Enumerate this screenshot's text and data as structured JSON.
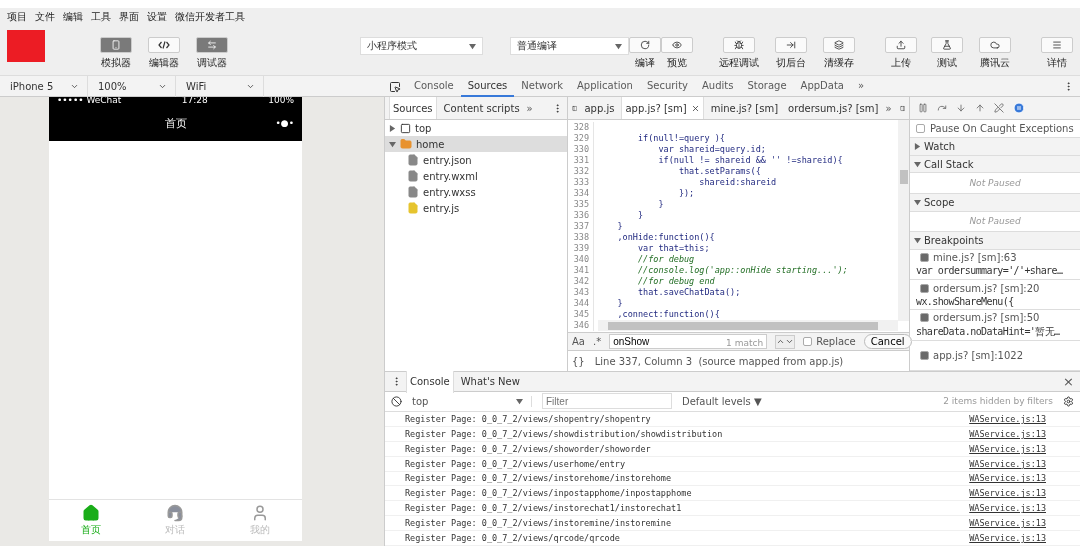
{
  "menu": [
    "项目",
    "文件",
    "编辑",
    "工具",
    "界面",
    "设置",
    "微信开发者工具"
  ],
  "view_buttons": [
    {
      "label": "模拟器",
      "selected": true
    },
    {
      "label": "编辑器",
      "selected": false
    },
    {
      "label": "调试器",
      "selected": true
    }
  ],
  "mode_select": {
    "value": "小程序模式"
  },
  "compile_select": {
    "value": "普通编译"
  },
  "actions": [
    {
      "label": "编译"
    },
    {
      "label": "预览"
    },
    {
      "label": "远程调试"
    },
    {
      "label": "切后台"
    },
    {
      "label": "清缓存"
    },
    {
      "label": "上传"
    },
    {
      "label": "测试"
    },
    {
      "label": "腾讯云"
    },
    {
      "label": "详情"
    }
  ],
  "device_selects": [
    "iPhone 5",
    "100%",
    "WiFi"
  ],
  "devtools_tabs": [
    {
      "label": "Console",
      "selected": false
    },
    {
      "label": "Sources",
      "selected": true
    },
    {
      "label": "Network",
      "selected": false
    },
    {
      "label": "Application",
      "selected": false
    },
    {
      "label": "Security",
      "selected": false
    },
    {
      "label": "Audits",
      "selected": false
    },
    {
      "label": "Storage",
      "selected": false
    },
    {
      "label": "AppData",
      "selected": false
    }
  ],
  "devtools_more": "»",
  "phone": {
    "carrier": "••••• WeChat",
    "time": "17:28",
    "battery": "100%",
    "title": "首页",
    "more": "•●•",
    "tabbar": [
      {
        "label": "首页",
        "selected": true
      },
      {
        "label": "对话",
        "selected": false
      },
      {
        "label": "我的",
        "selected": false
      }
    ]
  },
  "navigator": {
    "tabs": [
      {
        "label": "Sources",
        "selected": true
      },
      {
        "label": "Content scripts",
        "selected": false
      }
    ],
    "more": "»",
    "tree": [
      {
        "label": "top",
        "kind": "frame",
        "expanded": false,
        "selected": false
      },
      {
        "label": "home",
        "kind": "folder",
        "expanded": true,
        "selected": true,
        "children": [
          {
            "label": "entry.json",
            "kind": "file"
          },
          {
            "label": "entry.wxml",
            "kind": "file"
          },
          {
            "label": "entry.wxss",
            "kind": "file"
          },
          {
            "label": "entry.js",
            "kind": "script"
          }
        ]
      }
    ]
  },
  "editor": {
    "tabs": [
      {
        "label": "app.js",
        "selected": false,
        "closable": false
      },
      {
        "label": "app.js? [sm]",
        "selected": true,
        "closable": true
      },
      {
        "label": "mine.js? [sm]",
        "selected": false,
        "closable": false
      },
      {
        "label": "ordersum.js? [sm]",
        "selected": false,
        "closable": false
      }
    ],
    "more": "»",
    "lines": [
      {
        "number": "328"
      },
      {
        "number": "329",
        "text": "        if(null!=query ){",
        "kind": "code"
      },
      {
        "number": "330",
        "text": "            var shareid=query.id;",
        "kind": "code"
      },
      {
        "number": "331",
        "text": "            if(null != shareid && '' !=shareid){",
        "kind": "code"
      },
      {
        "number": "332",
        "text": "                that.setParams({",
        "kind": "code"
      },
      {
        "number": "333",
        "text": "                    shareid:shareid",
        "kind": "code"
      },
      {
        "number": "334",
        "text": "                });",
        "kind": "code"
      },
      {
        "number": "335",
        "text": "            }",
        "kind": "code"
      },
      {
        "number": "336",
        "text": "        }",
        "kind": "code"
      },
      {
        "number": "337",
        "text": "    }",
        "kind": "code"
      },
      {
        "number": "338",
        "text": "    ,onHide:function(){",
        "kind": "code"
      },
      {
        "number": "339",
        "text": "        var that=this;",
        "kind": "code"
      },
      {
        "number": "340",
        "text": "        //for debug",
        "kind": "comment"
      },
      {
        "number": "341",
        "text": "        //console.log('app::onHide starting...');",
        "kind": "comment"
      },
      {
        "number": "342",
        "text": "        //for debug end",
        "kind": "comment"
      },
      {
        "number": "343",
        "text": "        that.saveChatData();",
        "kind": "code"
      },
      {
        "number": "344",
        "text": "    }",
        "kind": "code"
      },
      {
        "number": "345",
        "text": "    ,connect:function(){",
        "kind": "code"
      },
      {
        "number": "346"
      }
    ],
    "search": {
      "case": "Aa",
      "regex": ".*",
      "value": "onShow",
      "matches": "1 match",
      "replace_label": "Replace",
      "replace_checked": false,
      "cancel": "Cancel"
    },
    "status": {
      "format": "{}",
      "text": "Line 337, Column 3  (source mapped from app.js)"
    }
  },
  "debugger": {
    "pause_caught": {
      "label": "Pause On Caught Exceptions",
      "checked": false
    },
    "sections": [
      {
        "title": "Watch",
        "expanded": false
      },
      {
        "title": "Call Stack",
        "expanded": true,
        "empty": "Not Paused"
      },
      {
        "title": "Scope",
        "expanded": true,
        "empty": "Not Paused"
      },
      {
        "title": "Breakpoints",
        "expanded": true,
        "breakpoints": [
          {
            "location": "mine.js? [sm]:63",
            "code": "var ordersummary='/'+share…",
            "checked": true
          },
          {
            "location": "ordersum.js? [sm]:20",
            "code": "wx.showShareMenu({",
            "checked": true
          },
          {
            "location": "ordersum.js? [sm]:50",
            "code": "shareData.noDataHint='暂无…",
            "checked": true
          },
          {
            "location": "app.js? [sm]:1022",
            "checked": true
          }
        ]
      }
    ]
  },
  "console": {
    "tabs": [
      {
        "label": "Console",
        "selected": true
      },
      {
        "label": "What's New",
        "selected": false
      }
    ],
    "close": "×",
    "context": "top",
    "filter_placeholder": "Filter",
    "levels": "Default levels ▼",
    "hidden": "2 items hidden by filters",
    "messages": [
      {
        "text": "Register Page: 0_0_7_2/views/shopentry/shopentry",
        "source": "WAService.js:13"
      },
      {
        "text": "Register Page: 0_0_7_2/views/showdistribution/showdistribution",
        "source": "WAService.js:13"
      },
      {
        "text": "Register Page: 0_0_7_2/views/showorder/showorder",
        "source": "WAService.js:13"
      },
      {
        "text": "Register Page: 0_0_7_2/views/userhome/entry",
        "source": "WAService.js:13"
      },
      {
        "text": "Register Page: 0_0_7_2/views/instorehome/instorehome",
        "source": "WAService.js:13"
      },
      {
        "text": "Register Page: 0_0_7_2/views/inpostapphome/inpostapphome",
        "source": "WAService.js:13"
      },
      {
        "text": "Register Page: 0_0_7_2/views/instorechat1/instorechat1",
        "source": "WAService.js:13"
      },
      {
        "text": "Register Page: 0_0_7_2/views/instoremine/instoremine",
        "source": "WAService.js:13"
      },
      {
        "text": "Register Page: 0_0_7_2/views/qrcode/qrcode",
        "source": "WAService.js:13"
      }
    ]
  }
}
